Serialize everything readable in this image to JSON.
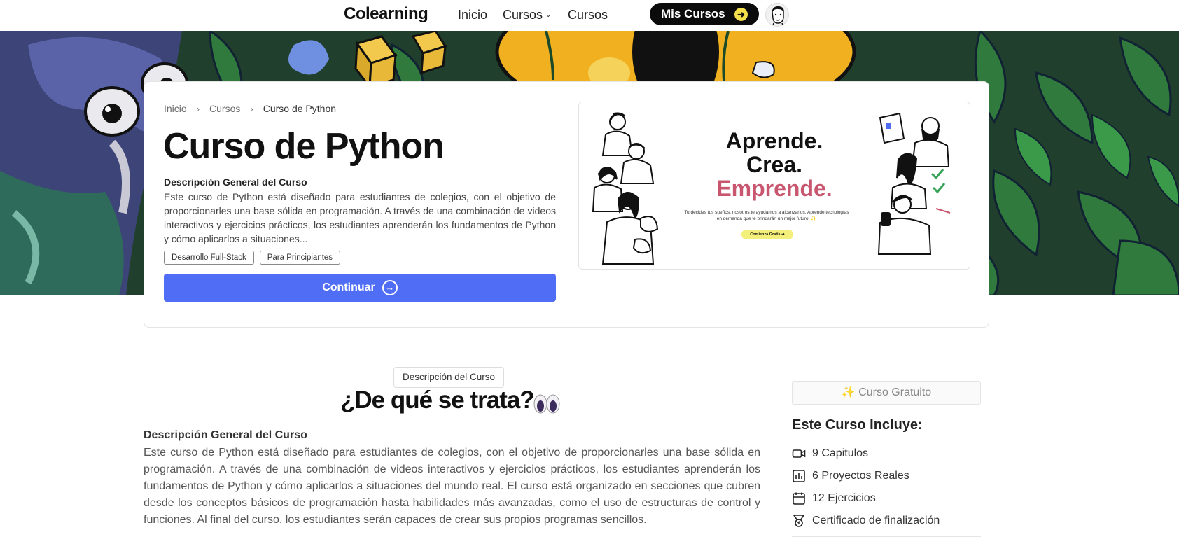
{
  "nav": {
    "brand": "Colearning",
    "links": [
      "Inicio",
      "Cursos",
      "Cursos"
    ],
    "my_courses": "Mis Cursos"
  },
  "breadcrumb": [
    "Inicio",
    "Cursos",
    "Curso de Python"
  ],
  "course": {
    "title": "Curso de Python",
    "overview_heading": "Descripción General del Curso",
    "overview_excerpt": "Este curso de Python está diseñado para estudiantes de colegios, con el objetivo de proporcionarles una base sólida en programación. A través de una combinación de videos interactivos y ejercicios prácticos, los estudiantes aprenderán los fundamentos de Python y cómo aplicarlos a situaciones...",
    "tags": [
      "Desarrollo Full-Stack",
      "Para Principiantes"
    ],
    "cta": "Continuar"
  },
  "promo": {
    "line1": "Aprende.",
    "line2": "Crea.",
    "line3": "Emprende.",
    "small_text": "Tu decides tus sueños, nosotros te ayudamos a alcanzarlos. Aprende tecnologías en demanda que te brindarán un mejor futuro. ✨",
    "button": "Comienza Gratis ➜"
  },
  "section": {
    "badge": "Descripción del Curso",
    "title": "¿De qué se trata?",
    "overview_heading": "Descripción General del Curso",
    "overview_full": "Este curso de Python está diseñado para estudiantes de colegios, con el objetivo de proporcionarles una base sólida en programación. A través de una combinación de videos interactivos y ejercicios prácticos, los estudiantes aprenderán los fundamentos de Python y cómo aplicarlos a situaciones del mundo real. El curso está organizado en secciones que cubren desde los conceptos básicos de programación hasta habilidades más avanzadas, como el uso de estructuras de control y funciones. Al final del curso, los estudiantes serán capaces de crear sus propios programas sencillos."
  },
  "sidebar": {
    "free_badge": "✨ Curso Gratuito",
    "includes_title": "Este Curso Incluye:",
    "items": [
      {
        "icon": "video-icon",
        "label": "9 Capitulos"
      },
      {
        "icon": "project-icon",
        "label": "6 Proyectos Reales"
      },
      {
        "icon": "calendar-icon",
        "label": "12 Ejercicios"
      },
      {
        "icon": "certificate-icon",
        "label": "Certificado de finalización"
      }
    ]
  },
  "colors": {
    "primary_button": "#4f6df5",
    "accent_pink": "#c9566f",
    "nav_button": "#0b0b0b",
    "arrow_yellow": "#f4e04d"
  }
}
